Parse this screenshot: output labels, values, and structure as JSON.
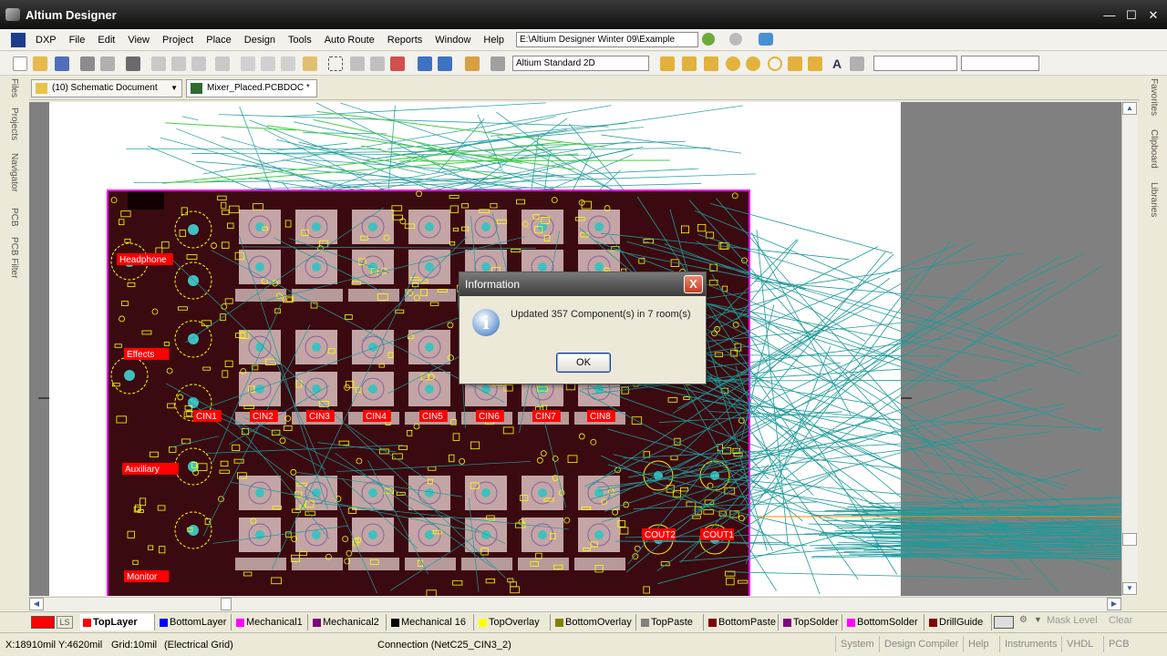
{
  "window": {
    "title": "Altium Designer"
  },
  "menu": {
    "items": [
      "DXP",
      "File",
      "Edit",
      "View",
      "Project",
      "Place",
      "Design",
      "Tools",
      "Auto Route",
      "Reports",
      "Window",
      "Help"
    ],
    "path": "E:\\Altium Designer Winter 09\\Example"
  },
  "toolbar": {
    "view_mode": "Altium Standard 2D"
  },
  "documents": {
    "tabs": [
      {
        "label": "(10) Schematic Document"
      },
      {
        "label": "Mixer_Placed.PCBDOC *"
      }
    ]
  },
  "left_panels": [
    "Files",
    "Projects",
    "Navigator",
    "PCB",
    "PCB Filter"
  ],
  "right_panels": [
    "Favorites",
    "Clipboard",
    "Libraries"
  ],
  "pcb": {
    "labels": [
      "Headphone",
      "Effects",
      "Auxiliary",
      "Monitor",
      "CIN1",
      "CIN2",
      "CIN3",
      "CIN4",
      "CIN5",
      "CIN6",
      "CIN7",
      "CIN8",
      "COUT2",
      "COUT1"
    ],
    "colors": {
      "board": "#3a0a10",
      "outline": "#ff00ff",
      "pad": "#c4a5a5",
      "pad_center": "#3fc0c0",
      "ratsnest": "#1f9a9a",
      "silk": "#ffff00",
      "sheet": "#ffffff",
      "workspace": "#808080"
    }
  },
  "dialog": {
    "title": "Information",
    "message": "Updated 357 Component(s) in 7 room(s)",
    "ok_label": "OK",
    "close_label": "X"
  },
  "layers": {
    "current_swatch": "#ff0000",
    "ls_label": "LS",
    "tabs": [
      {
        "label": "TopLayer",
        "color": "#ff0000"
      },
      {
        "label": "BottomLayer",
        "color": "#0000ff"
      },
      {
        "label": "Mechanical1",
        "color": "#ff00ff"
      },
      {
        "label": "Mechanical2",
        "color": "#800080"
      },
      {
        "label": "Mechanical 16",
        "color": "#000000"
      },
      {
        "label": "TopOverlay",
        "color": "#ffff00"
      },
      {
        "label": "BottomOverlay",
        "color": "#808000"
      },
      {
        "label": "TopPaste",
        "color": "#808080"
      },
      {
        "label": "BottomPaste",
        "color": "#800000"
      },
      {
        "label": "TopSolder",
        "color": "#800080"
      },
      {
        "label": "BottomSolder",
        "color": "#ff00ff"
      },
      {
        "label": "DrillGuide",
        "color": "#800000"
      }
    ],
    "mask_level": "Mask Level",
    "clear": "Clear"
  },
  "status": {
    "coords": "X:18910mil Y:4620mil",
    "grid": "Grid:10mil",
    "grid_type": "(Electrical Grid)",
    "connection": "Connection (NetC25_CIN3_2)",
    "buttons": [
      "System",
      "Design Compiler",
      "Help",
      "Instruments",
      "VHDL",
      "PCB"
    ]
  }
}
